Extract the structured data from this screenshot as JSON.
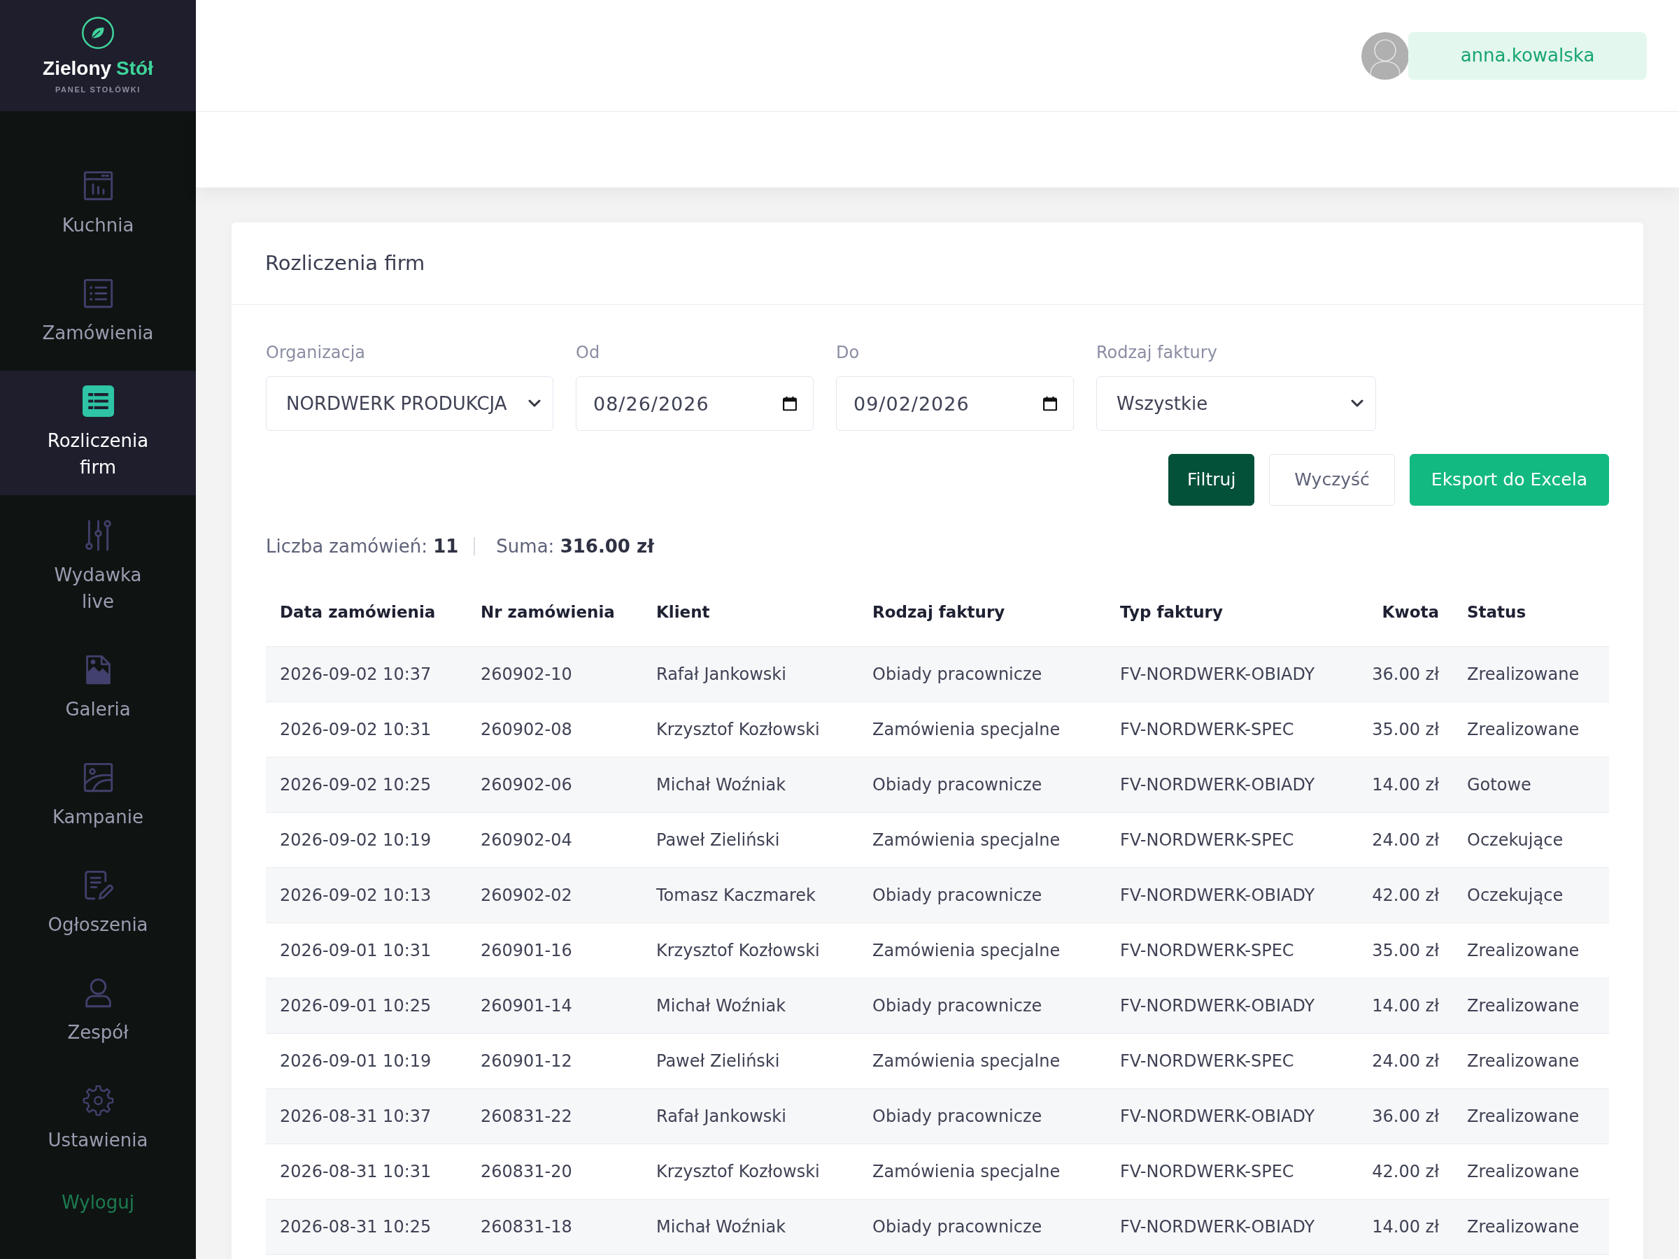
{
  "brand": {
    "name": "Zielony",
    "accent": "Stół",
    "subtitle": "PANEL STOŁÓWKI"
  },
  "sidebar": {
    "items": [
      {
        "label": "Kuchnia",
        "selected": false
      },
      {
        "label": "Zamówienia",
        "selected": false
      },
      {
        "label": "Rozliczenia firm",
        "selected": true
      },
      {
        "label": "Wydawka live",
        "selected": false
      },
      {
        "label": "Galeria",
        "selected": false
      },
      {
        "label": "Kampanie",
        "selected": false
      },
      {
        "label": "Ogłoszenia",
        "selected": false
      },
      {
        "label": "Zespół",
        "selected": false
      },
      {
        "label": "Ustawienia",
        "selected": false
      }
    ],
    "logout": "Wyloguj"
  },
  "header": {
    "user": "anna.kowalska"
  },
  "card": {
    "title": "Rozliczenia firm",
    "filters": [
      {
        "kind": "select",
        "label": "Organizacja",
        "value": "NORDWERK PRODUKCJA"
      },
      {
        "kind": "date",
        "label": "Od",
        "value": "08/26/2026"
      },
      {
        "kind": "date",
        "label": "Do",
        "value": "09/02/2026"
      },
      {
        "kind": "select",
        "label": "Rodzaj faktury",
        "value": "Wszystkie"
      }
    ],
    "buttons": [
      {
        "kind": "primary",
        "label": "Filtruj"
      },
      {
        "kind": "plain",
        "label": "Wyczyść"
      },
      {
        "kind": "accent",
        "label": "Eksport do Excela"
      }
    ],
    "summary": {
      "count": "Liczba zamówień: **11**",
      "total": "Suma: **316.00 zł**"
    },
    "table": {
      "columns": [
        {
          "label": "Data zamówienia",
          "kind": "text"
        },
        {
          "label": "Nr zamówienia",
          "kind": "text"
        },
        {
          "label": "Klient",
          "kind": "text"
        },
        {
          "label": "Rodzaj faktury",
          "kind": "text"
        },
        {
          "label": "Typ faktury",
          "kind": "text"
        },
        {
          "label": "Kwota",
          "kind": "amount"
        },
        {
          "label": "Status",
          "kind": "text"
        }
      ],
      "rows": [
        [
          "2026-09-02 10:37",
          "260902-10",
          "Rafał Jankowski",
          "Obiady pracownicze",
          "FV-NORDWERK-OBIADY",
          "36.00 zł",
          "Zrealizowane"
        ],
        [
          "2026-09-02 10:31",
          "260902-08",
          "Krzysztof Kozłowski",
          "Zamówienia specjalne",
          "FV-NORDWERK-SPEC",
          "35.00 zł",
          "Zrealizowane"
        ],
        [
          "2026-09-02 10:25",
          "260902-06",
          "Michał Woźniak",
          "Obiady pracownicze",
          "FV-NORDWERK-OBIADY",
          "14.00 zł",
          "Gotowe"
        ],
        [
          "2026-09-02 10:19",
          "260902-04",
          "Paweł Zieliński",
          "Zamówienia specjalne",
          "FV-NORDWERK-SPEC",
          "24.00 zł",
          "Oczekujące"
        ],
        [
          "2026-09-02 10:13",
          "260902-02",
          "Tomasz Kaczmarek",
          "Obiady pracownicze",
          "FV-NORDWERK-OBIADY",
          "42.00 zł",
          "Oczekujące"
        ],
        [
          "2026-09-01 10:31",
          "260901-16",
          "Krzysztof Kozłowski",
          "Zamówienia specjalne",
          "FV-NORDWERK-SPEC",
          "35.00 zł",
          "Zrealizowane"
        ],
        [
          "2026-09-01 10:25",
          "260901-14",
          "Michał Woźniak",
          "Obiady pracownicze",
          "FV-NORDWERK-OBIADY",
          "14.00 zł",
          "Zrealizowane"
        ],
        [
          "2026-09-01 10:19",
          "260901-12",
          "Paweł Zieliński",
          "Zamówienia specjalne",
          "FV-NORDWERK-SPEC",
          "24.00 zł",
          "Zrealizowane"
        ],
        [
          "2026-08-31 10:37",
          "260831-22",
          "Rafał Jankowski",
          "Obiady pracownicze",
          "FV-NORDWERK-OBIADY",
          "36.00 zł",
          "Zrealizowane"
        ],
        [
          "2026-08-31 10:31",
          "260831-20",
          "Krzysztof Kozłowski",
          "Zamówienia specjalne",
          "FV-NORDWERK-SPEC",
          "42.00 zł",
          "Zrealizowane"
        ],
        [
          "2026-08-31 10:25",
          "260831-18",
          "Michał Woźniak",
          "Obiady pracownicze",
          "FV-NORDWERK-OBIADY",
          "14.00 zł",
          "Zrealizowane"
        ]
      ]
    }
  }
}
